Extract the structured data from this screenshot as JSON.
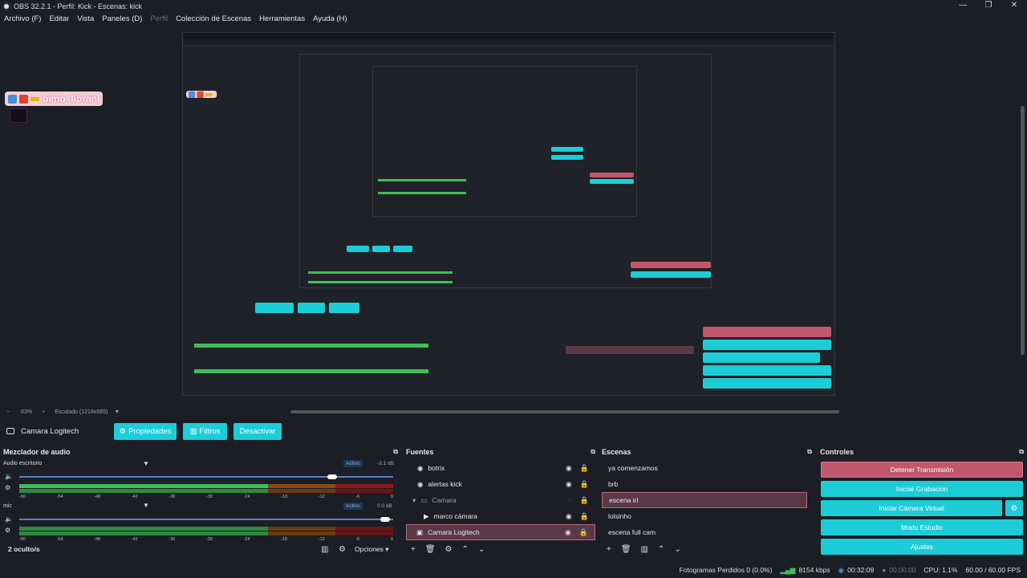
{
  "window": {
    "title": "OBS 32.2.1 - Perfil: Kick - Escenas: kick",
    "minimize": "—",
    "maximize": "❐",
    "close": "✕"
  },
  "menu": [
    "Archivo (F)",
    "Editar",
    "Vista",
    "Paneles (D)",
    "Perfil",
    "Colección de Escenas",
    "Herramientas",
    "Ayuda (H)"
  ],
  "preview": {
    "badge_name": "bimo_libranl",
    "zoom_minus": "−",
    "zoom_value": "63%",
    "zoom_plus": "+",
    "scale_label": "Escalado (1218x685)"
  },
  "source_toolbar": {
    "source_name": "Camara Logitech",
    "properties": "Propiedades",
    "filters": "Filtros",
    "deactivate": "Desactivar"
  },
  "mixer": {
    "title": "Mezclador de audio",
    "channels": [
      {
        "name": "Audio escritorio",
        "status": "Activo",
        "db": "-3.1 dB",
        "volume_fraction": 0.83
      },
      {
        "name": "mic",
        "status": "Activo",
        "db": "0.0 dB",
        "volume_fraction": 0.97
      }
    ],
    "ticks": [
      "-60",
      "-54",
      "-48",
      "-42",
      "-36",
      "-30",
      "-24",
      "-18",
      "-12",
      "-6",
      "0"
    ],
    "hidden": "2 oculto/s",
    "options": "Opciones"
  },
  "sources": {
    "title": "Fuentes",
    "items": [
      {
        "label": "botrix",
        "kind": "browser"
      },
      {
        "label": "alertas kick",
        "kind": "browser"
      },
      {
        "label": "Camara",
        "kind": "group"
      },
      {
        "label": "marco cámara",
        "kind": "media"
      },
      {
        "label": "Camara Logitech",
        "kind": "camera",
        "selected": true
      }
    ]
  },
  "scenes": {
    "title": "Escenas",
    "items": [
      {
        "label": "ya comenzamos"
      },
      {
        "label": "brb"
      },
      {
        "label": "escena irl",
        "selected": true
      },
      {
        "label": "lolsinho"
      },
      {
        "label": "escena full cam"
      }
    ]
  },
  "controls": {
    "title": "Controles",
    "stop_stream": "Detener Transmisión",
    "start_recording": "Iniciar Grabación",
    "start_virtual_cam": "Iniciar Cámara Virtual",
    "studio_mode": "Modo Estudio",
    "settings": "Ajustes"
  },
  "status": {
    "dropped": "Fotogramas Perdidos 0 (0.0%)",
    "kbps": "8154 kbps",
    "stream_time": "00:32:09",
    "rec_time": "00:00:00",
    "cpu": "CPU: 1.1%",
    "fps": "60.00 / 60.00 FPS"
  },
  "colors": {
    "accent_teal": "#1ccdd8",
    "accent_pink": "#c0576b",
    "meter_green": "#3fbf58",
    "meter_orange": "#8a4a14",
    "meter_red": "#8a1c1c"
  }
}
